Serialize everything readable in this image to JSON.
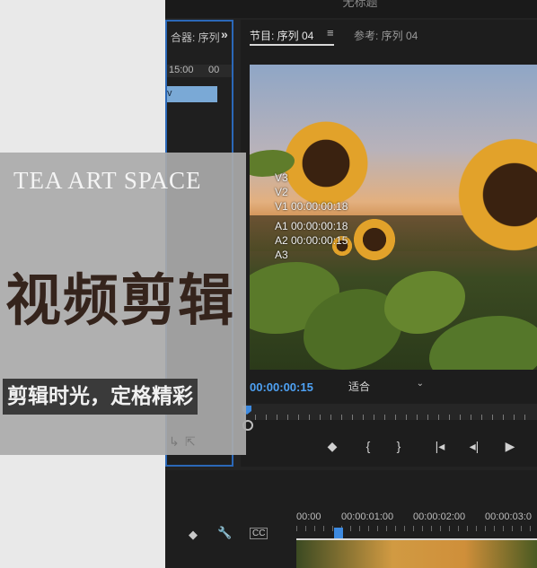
{
  "window": {
    "title": "无标题"
  },
  "source_panel": {
    "tab_label": "合器: 序列",
    "overflow": "»",
    "ruler": [
      "15:00",
      "00"
    ],
    "clip_label": "v"
  },
  "program_panel": {
    "tab_label": "节目: 序列 04",
    "menu_icon": "≡",
    "ref_tab_label": "参考: 序列 04",
    "overlay_lines": [
      "V3",
      "V2",
      "V1 00:00:00:18",
      "A1 00:00:00:18",
      "A2 00:00:00:15",
      "A3"
    ],
    "timecode": "00:00:00:15",
    "fit_label": "适合",
    "fit_chevron": "⌄"
  },
  "transport": {
    "marker": "◆",
    "in_point": "{",
    "out_point": "}",
    "go_to_in": "|◂",
    "step_back": "◂|",
    "play": "▶"
  },
  "timeline": {
    "ruler": [
      "00:00",
      "00:00:01:00",
      "00:00:02:00",
      "00:00:03:0"
    ],
    "icons": {
      "marker": "◆",
      "wrench": "🔧",
      "captions": "CC"
    }
  },
  "overlay": {
    "brand": "TEA ART SPACE",
    "headline": "视频剪辑",
    "subtitle": "剪辑时光，定格精彩"
  },
  "colors": {
    "accent": "#4ea1f3",
    "panel_border": "#2b68b8",
    "headline": "#35241c"
  }
}
